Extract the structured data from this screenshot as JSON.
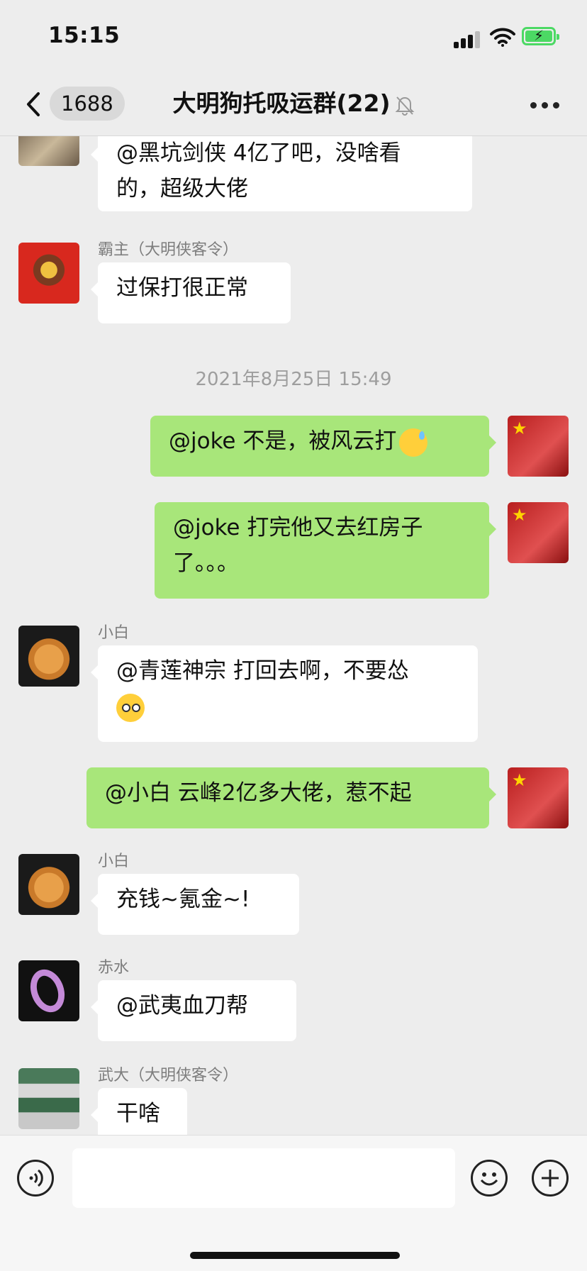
{
  "status_bar": {
    "time": "15:15"
  },
  "nav": {
    "back_count": "1688",
    "title": "大明狗托吸运群(22)",
    "icons": [
      "chevron-left-icon",
      "bell-off-icon",
      "more-icon"
    ]
  },
  "messages": [
    {
      "side": "left",
      "sender": "",
      "lines": [
        "@黑坑剑侠 4亿了吧，没啥看",
        "的，超级大佬"
      ]
    },
    {
      "side": "left",
      "sender": "霸主（大明侠客令）",
      "lines": [
        "过保打很正常"
      ]
    },
    {
      "type": "timestamp",
      "text": "2021年8月25日 15:49"
    },
    {
      "side": "right",
      "lines": [
        "@joke  不是，被风云打"
      ],
      "emoji": "sweat-smile-emoji"
    },
    {
      "side": "right",
      "lines": [
        "@joke  打完他又去红房子",
        "了。。。"
      ]
    },
    {
      "side": "left",
      "sender": "小白",
      "lines": [
        "@青莲神宗 打回去啊，不要怂"
      ],
      "emoji": "pleading-emoji"
    },
    {
      "side": "right",
      "lines": [
        "@小白 云峰2亿多大佬，惹不起"
      ]
    },
    {
      "side": "left",
      "sender": "小白",
      "lines": [
        "充钱~氪金~!"
      ]
    },
    {
      "side": "left",
      "sender": "赤水",
      "lines": [
        "@武夷血刀帮"
      ]
    },
    {
      "side": "left",
      "sender": "武大（大明侠客令）",
      "lines": [
        "干啥"
      ]
    }
  ],
  "input_bar": {
    "icons": [
      "voice-icon",
      "emoji-icon",
      "plus-icon"
    ],
    "value": ""
  },
  "colors": {
    "my_bubble": "#a8e67a",
    "other_bubble": "#ffffff",
    "background": "#ededed"
  }
}
